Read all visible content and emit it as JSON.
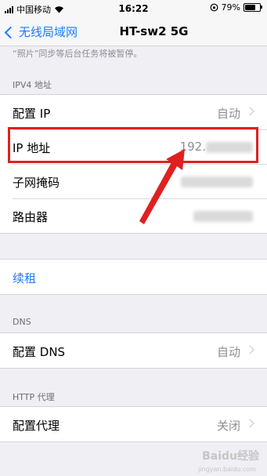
{
  "status_bar": {
    "carrier": "中国移动",
    "time": "16:22",
    "battery_percent": "79%",
    "battery_level": 0.79
  },
  "nav": {
    "back_label": "无线局域网",
    "title": "HT-sw2 5G"
  },
  "note": "“照片”同步等后台任务将被暂停。",
  "ipv4": {
    "header": "IPV4 地址",
    "rows": [
      {
        "label": "配置 IP",
        "value": "自动"
      },
      {
        "label": "IP 地址",
        "value": "192."
      },
      {
        "label": "子网掩码",
        "value": ""
      },
      {
        "label": "路由器",
        "value": ""
      }
    ]
  },
  "lease": {
    "label": "续租"
  },
  "dns": {
    "header": "DNS",
    "row": {
      "label": "配置 DNS",
      "value": "自动"
    }
  },
  "http_proxy": {
    "header": "HTTP 代理",
    "row": {
      "label": "配置代理",
      "value": "关闭"
    }
  },
  "watermark": {
    "logo": "Baidu经验",
    "sub": "jingyan.baidu.com"
  },
  "colors": {
    "accent": "#1a7ef7",
    "annotation": "#e02020",
    "background": "#efeff4"
  }
}
